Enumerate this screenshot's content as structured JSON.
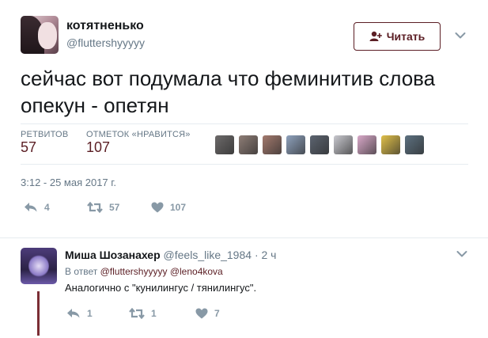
{
  "tweet": {
    "author_name": "котятненько",
    "author_handle": "@fluttershyyyyy",
    "follow_label": "Читать",
    "text": "сейчас вот подумала что феминитив слова опекун - опетян",
    "retweets_label": "РЕТВИТОВ",
    "retweets_count": "57",
    "likes_label": "ОТМЕТОК «НРАВИТСЯ»",
    "likes_count": "107",
    "timestamp": "3:12 - 25 мая 2017 г.",
    "actions": {
      "replies": "4",
      "retweets": "57",
      "likes": "107"
    }
  },
  "liker_avatars": [
    "#6d6a6a",
    "#8e7d76",
    "#a37a6e",
    "#8fa2bd",
    "#5c6470",
    "#c9c9cf",
    "#d9a9c9",
    "#e0c04a",
    "#5d7180"
  ],
  "reply": {
    "author_name": "Миша Шозанахер",
    "author_handle": "@feels_like_1984",
    "time": "2 ч",
    "replying_prefix": "В ответ",
    "replying_to_1": "@fluttershyyyyy",
    "replying_to_2": "@leno4kova",
    "text": "Аналогично с \"кунилингус / тянилингус\".",
    "actions": {
      "replies": "1",
      "retweets": "1",
      "likes": "7"
    }
  },
  "colors": {
    "accent": "#5b1e24",
    "muted": "#657786",
    "icon": "#8899a6"
  }
}
